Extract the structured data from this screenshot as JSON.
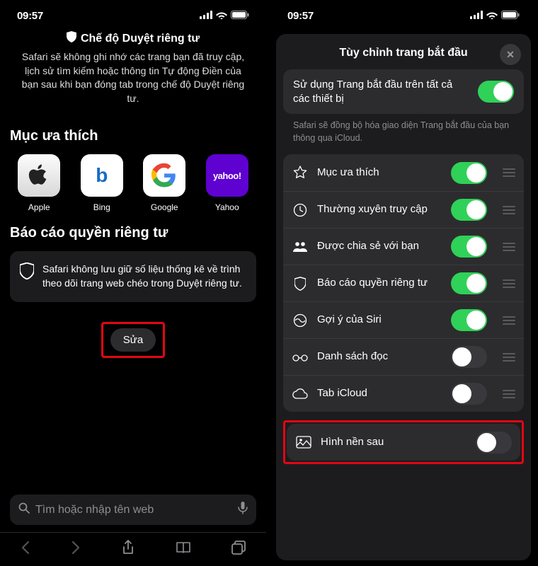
{
  "status": {
    "time": "09:57"
  },
  "left": {
    "private_mode": {
      "title": "Chế độ Duyệt riêng tư",
      "desc": "Safari sẽ không ghi nhớ các trang bạn đã truy cập, lịch sử tìm kiếm hoặc thông tin Tự động Điền của bạn sau khi bạn đóng tab trong chế độ Duyệt riêng tư."
    },
    "favorites_title": "Mục ưa thích",
    "favorites": [
      {
        "label": "Apple"
      },
      {
        "label": "Bing"
      },
      {
        "label": "Google"
      },
      {
        "label": "Yahoo"
      }
    ],
    "privacy_section_title": "Báo cáo quyền riêng tư",
    "privacy_card_text": "Safari không lưu giữ số liệu thống kê về trình theo dõi trang web chéo trong Duyệt riêng tư.",
    "edit_button": "Sửa",
    "search_placeholder": "Tìm hoặc nhập tên web"
  },
  "right": {
    "sheet_title": "Tùy chỉnh trang bắt đầu",
    "sync_text": "Sử dụng Trang bắt đầu trên tất cả các thiết bị",
    "sync_desc": "Safari sẽ đồng bộ hóa giao diện Trang bắt đầu của bạn thông qua iCloud.",
    "options": [
      {
        "label": "Mục ưa thích",
        "on": true
      },
      {
        "label": "Thường xuyên truy cập",
        "on": true
      },
      {
        "label": "Được chia sẻ với bạn",
        "on": true
      },
      {
        "label": "Báo cáo quyền riêng tư",
        "on": true
      },
      {
        "label": "Gợi ý của Siri",
        "on": true
      },
      {
        "label": "Danh sách đọc",
        "on": false
      },
      {
        "label": "Tab iCloud",
        "on": false
      }
    ],
    "background_label": "Hình nền sau"
  },
  "icons": {
    "yahoo_text": "yahoo!",
    "bing_letter": "b"
  }
}
